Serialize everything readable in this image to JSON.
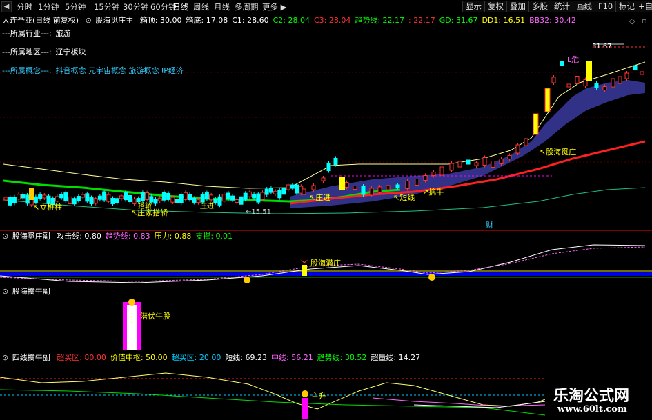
{
  "toolbar": {
    "periods": [
      "分时",
      "1分钟",
      "5分钟",
      "15分钟",
      "30分钟",
      "60分钟",
      "日线",
      "周线",
      "月线",
      "多周期",
      "更多"
    ],
    "active_period": "日线",
    "right_buttons": [
      "显示",
      "复权",
      "叠加",
      "多股",
      "统计",
      "画线",
      "F10",
      "标记",
      "+自选"
    ]
  },
  "header": {
    "stock": "大连圣亚(日线 前复权)",
    "indicator": "股海觅庄主",
    "values": [
      {
        "label": "箱顶: 30.00",
        "color": "#ffffff"
      },
      {
        "label": "箱底: 17.08",
        "color": "#ffffff"
      },
      {
        "label": "C1: 28.60",
        "color": "#ffffff"
      },
      {
        "label": "C2: 28.04",
        "color": "#00ff00"
      },
      {
        "label": "C3: 28.04",
        "color": "#ff3333"
      },
      {
        "label": "趋势线: 22.17",
        "color": "#00ff00"
      },
      {
        "label": ": 22.17",
        "color": "#ff3333"
      },
      {
        "label": "GD: 31.67",
        "color": "#00ff00"
      },
      {
        "label": "DD1: 16.51",
        "color": "#ffff00"
      },
      {
        "label": "BB32: 30.42",
        "color": "#ff66ff"
      }
    ]
  },
  "info": {
    "industry_label": "---所属行业---:",
    "industry_value": "旅游",
    "region_label": "---所属地区---:",
    "region_value": "辽宁板块",
    "concept_label": "---所属概念---:",
    "concept_value": "抖音概念 元宇宙概念 旅游概念 IP经济"
  },
  "main_annotations": {
    "high_price": "31.67",
    "low_price": "←15.51",
    "danger": "L危",
    "stand_pillar": "立桩柱",
    "dealer_suck": "庄家搭轿",
    "dealer_enter": "庄进",
    "short_line": "短线",
    "grab_bull": "擒牛",
    "seek_dealer": "股海觅庄",
    "wealth": "财",
    "small_labels": [
      "搭轿",
      "庄进"
    ]
  },
  "panel2": {
    "title": "股海觅庄副",
    "values": [
      {
        "label": "攻击线: 0.80",
        "color": "#ffffff"
      },
      {
        "label": "趋势线: 0.83",
        "color": "#ff66ff"
      },
      {
        "label": "压力: 0.88",
        "color": "#ffff00"
      },
      {
        "label": "支撑: 0.01",
        "color": "#00ff00"
      }
    ],
    "signal": "股海潜庄"
  },
  "panel3": {
    "title": "股海擒牛副",
    "signal": "潜伏牛股"
  },
  "panel4": {
    "title": "四线擒牛副",
    "values": [
      {
        "label": "超买区: 80.00",
        "color": "#ff3333"
      },
      {
        "label": "价值中枢: 50.00",
        "color": "#ffff00"
      },
      {
        "label": "超买区: 20.00",
        "color": "#00ccff"
      },
      {
        "label": "短线: 69.23",
        "color": "#ffffff"
      },
      {
        "label": "中线: 56.21",
        "color": "#ff66ff"
      },
      {
        "label": "趋势线: 38.52",
        "color": "#00ff00"
      },
      {
        "label": "超量线: 14.27",
        "color": "#ffffff"
      }
    ],
    "signal": "主升"
  },
  "watermark": {
    "title": "乐淘公式网",
    "url": "www.60lt.com"
  },
  "colors": {
    "up": "#ff3333",
    "down": "#00ffff",
    "trend": "#00ff00",
    "signal_yellow": "#ffff00",
    "magenta": "#ff00ff",
    "cloud": "#3a3aa0"
  }
}
